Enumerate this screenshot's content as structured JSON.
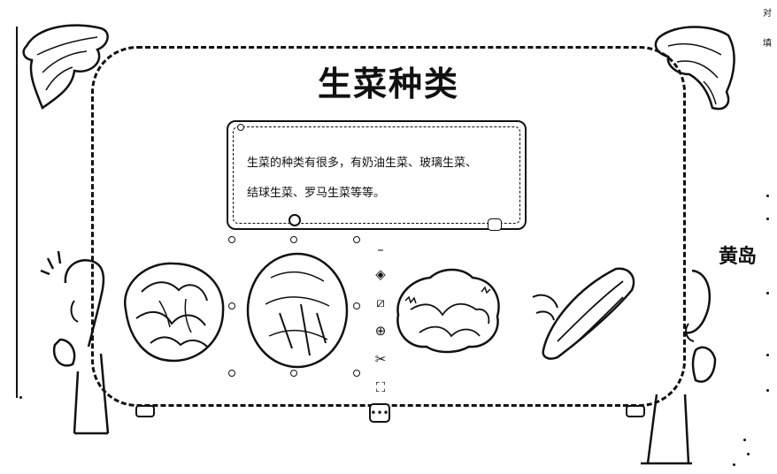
{
  "slide": {
    "title": "生菜种类",
    "body_line1": "生菜的种类有很多，有奶油生菜、玻璃生菜、",
    "body_line2": "结球生菜、罗马生菜等等。"
  },
  "images": [
    {
      "name": "butter-lettuce",
      "label": ""
    },
    {
      "name": "iceberg-lettuce",
      "label": ""
    },
    {
      "name": "frisee-lettuce",
      "label": ""
    },
    {
      "name": "romaine-lettuce",
      "label": ""
    }
  ],
  "toolbar": {
    "items": [
      {
        "icon": "minus-icon",
        "glyph": "–"
      },
      {
        "icon": "layers-icon",
        "glyph": "◈"
      },
      {
        "icon": "crop-icon",
        "glyph": "⧄"
      },
      {
        "icon": "zoom-in-icon",
        "glyph": "⊕"
      },
      {
        "icon": "magic-tools-icon",
        "glyph": "✂"
      },
      {
        "icon": "fullscreen-icon",
        "glyph": "⛶"
      }
    ],
    "more_glyph": "•••"
  },
  "right_panel": {
    "top_char": "对",
    "second_char": "填",
    "logo_text": "黄岛"
  },
  "colors": {
    "ink": "#111111",
    "paper": "#ffffff"
  }
}
